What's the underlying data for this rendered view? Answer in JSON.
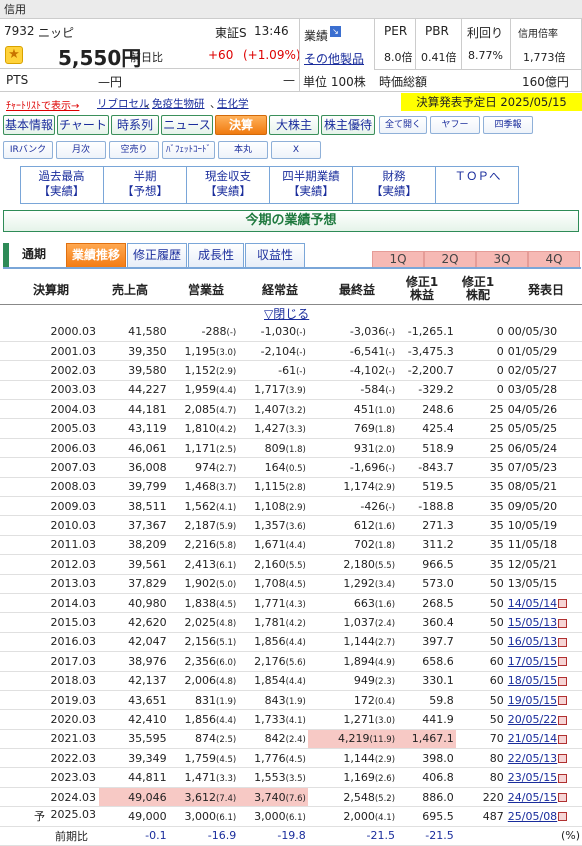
{
  "top": {
    "credit": "信用",
    "code": "7932",
    "name": "ニッピ",
    "market": "東証S",
    "time": "13:46",
    "price": "5,550円",
    "prev_label": "前日比",
    "change": "+60",
    "change_pct": "(+1.09%)",
    "pts_label": "PTS",
    "pts_value": "—円",
    "pts_dash": "—"
  },
  "sector": {
    "label": "業績",
    "value": "その他製品",
    "unit": "単位 100株"
  },
  "ratios": {
    "per_label": "PER",
    "per": "8.0倍",
    "pbr_label": "PBR",
    "pbr": "0.41倍",
    "yield_label": "利回り",
    "yield": "8.77%",
    "margin_label": "信用倍率",
    "margin": "1,773倍"
  },
  "mcap": {
    "label": "時価総額",
    "value": "160億円"
  },
  "info": {
    "watch": "ﾁｬｰﾄﾘｽﾄで表示→",
    "link1": "リブロセル",
    "link2": "免疫生物研",
    "link3": "生化学",
    "sep": "、",
    "settlement": "決算発表予定日 2025/05/15"
  },
  "nav1": [
    "基本情報",
    "チャート",
    "時系列",
    "ニュース",
    "決算",
    "大株主",
    "株主優待",
    "全て開く",
    "ヤフー",
    "四季報"
  ],
  "nav2": [
    "IRバンク",
    "月次",
    "空売り",
    "ﾊﾞﾌｪｯﾄｺｰﾄﾞ",
    "本丸",
    "X"
  ],
  "subnav": [
    [
      "過去最高",
      "【実績】"
    ],
    [
      "半期",
      "【予想】"
    ],
    [
      "現金収支",
      "【実績】"
    ],
    [
      "四半期業績",
      "【実績】"
    ],
    [
      "財務",
      "【実績】"
    ],
    [
      "ＴＯＰへ",
      ""
    ]
  ],
  "section_title": "今期の業績予想",
  "tabs": {
    "period": "通期",
    "items": [
      "業績推移",
      "修正履歴",
      "成長性",
      "収益性"
    ],
    "quarters": [
      "1Q",
      "2Q",
      "3Q",
      "4Q"
    ]
  },
  "headers": [
    "決算期",
    "売上高",
    "営業益",
    "経常益",
    "最終益",
    "修正1株益",
    "修正1株配",
    "発表日"
  ],
  "close_label": "▽閉じる",
  "rows": [
    [
      "2000.03",
      "41,580",
      "-288",
      "(-)",
      "-1,030",
      "(-)",
      "-3,036",
      "(-)",
      "-1,265.1",
      "0",
      "00/05/30"
    ],
    [
      "2001.03",
      "39,350",
      "1,195",
      "(3.0)",
      "-2,104",
      "(-)",
      "-6,541",
      "(-)",
      "-3,475.3",
      "0",
      "01/05/29"
    ],
    [
      "2002.03",
      "39,580",
      "1,152",
      "(2.9)",
      "-61",
      "(-)",
      "-4,102",
      "(-)",
      "-2,200.7",
      "0",
      "02/05/27"
    ],
    [
      "2003.03",
      "44,227",
      "1,959",
      "(4.4)",
      "1,717",
      "(3.9)",
      "-584",
      "(-)",
      "-329.2",
      "0",
      "03/05/28"
    ],
    [
      "2004.03",
      "44,181",
      "2,085",
      "(4.7)",
      "1,407",
      "(3.2)",
      "451",
      "(1.0)",
      "248.6",
      "25",
      "04/05/26"
    ],
    [
      "2005.03",
      "43,119",
      "1,810",
      "(4.2)",
      "1,427",
      "(3.3)",
      "769",
      "(1.8)",
      "425.4",
      "25",
      "05/05/25"
    ],
    [
      "2006.03",
      "46,061",
      "1,171",
      "(2.5)",
      "809",
      "(1.8)",
      "931",
      "(2.0)",
      "518.9",
      "25",
      "06/05/24"
    ],
    [
      "2007.03",
      "36,008",
      "974",
      "(2.7)",
      "164",
      "(0.5)",
      "-1,696",
      "(-)",
      "-843.7",
      "35",
      "07/05/23"
    ],
    [
      "2008.03",
      "39,799",
      "1,468",
      "(3.7)",
      "1,115",
      "(2.8)",
      "1,174",
      "(2.9)",
      "519.5",
      "35",
      "08/05/21"
    ],
    [
      "2009.03",
      "38,511",
      "1,562",
      "(4.1)",
      "1,108",
      "(2.9)",
      "-426",
      "(-)",
      "-188.8",
      "35",
      "09/05/20"
    ],
    [
      "2010.03",
      "37,367",
      "2,187",
      "(5.9)",
      "1,357",
      "(3.6)",
      "612",
      "(1.6)",
      "271.3",
      "35",
      "10/05/19"
    ],
    [
      "2011.03",
      "38,209",
      "2,216",
      "(5.8)",
      "1,671",
      "(4.4)",
      "702",
      "(1.8)",
      "311.2",
      "35",
      "11/05/18"
    ],
    [
      "2012.03",
      "39,561",
      "2,413",
      "(6.1)",
      "2,160",
      "(5.5)",
      "2,180",
      "(5.5)",
      "966.5",
      "35",
      "12/05/21"
    ],
    [
      "2013.03",
      "37,829",
      "1,902",
      "(5.0)",
      "1,708",
      "(4.5)",
      "1,292",
      "(3.4)",
      "573.0",
      "50",
      "13/05/15"
    ],
    [
      "2014.03",
      "40,980",
      "1,838",
      "(4.5)",
      "1,771",
      "(4.3)",
      "663",
      "(1.6)",
      "268.5",
      "50",
      "14/05/14"
    ],
    [
      "2015.03",
      "42,620",
      "2,025",
      "(4.8)",
      "1,781",
      "(4.2)",
      "1,037",
      "(2.4)",
      "360.4",
      "50",
      "15/05/13"
    ],
    [
      "2016.03",
      "42,047",
      "2,156",
      "(5.1)",
      "1,856",
      "(4.4)",
      "1,144",
      "(2.7)",
      "397.7",
      "50",
      "16/05/13"
    ],
    [
      "2017.03",
      "38,976",
      "2,356",
      "(6.0)",
      "2,176",
      "(5.6)",
      "1,894",
      "(4.9)",
      "658.6",
      "60",
      "17/05/15"
    ],
    [
      "2018.03",
      "42,137",
      "2,006",
      "(4.8)",
      "1,854",
      "(4.4)",
      "949",
      "(2.3)",
      "330.1",
      "60",
      "18/05/15"
    ],
    [
      "2019.03",
      "43,651",
      "831",
      "(1.9)",
      "843",
      "(1.9)",
      "172",
      "(0.4)",
      "59.8",
      "50",
      "19/05/15"
    ],
    [
      "2020.03",
      "42,410",
      "1,856",
      "(4.4)",
      "1,733",
      "(4.1)",
      "1,271",
      "(3.0)",
      "441.9",
      "50",
      "20/05/22"
    ],
    [
      "2021.03",
      "35,595",
      "874",
      "(2.5)",
      "842",
      "(2.4)",
      "4,219",
      "(11.9)",
      "1,467.1",
      "70",
      "21/05/14"
    ],
    [
      "2022.03",
      "39,349",
      "1,759",
      "(4.5)",
      "1,776",
      "(4.5)",
      "1,144",
      "(2.9)",
      "398.0",
      "80",
      "22/05/13"
    ],
    [
      "2023.03",
      "44,811",
      "1,471",
      "(3.3)",
      "1,553",
      "(3.5)",
      "1,169",
      "(2.6)",
      "406.8",
      "80",
      "23/05/15"
    ],
    [
      "2024.03",
      "49,046",
      "3,612",
      "(7.4)",
      "3,740",
      "(7.6)",
      "2,548",
      "(5.2)",
      "886.0",
      "220",
      "24/05/15"
    ],
    [
      "2025.03",
      "49,000",
      "3,000",
      "(6.1)",
      "3,000",
      "(6.1)",
      "2,000",
      "(4.1)",
      "695.5",
      "487",
      "25/05/08"
    ]
  ],
  "forecast_mark": "予",
  "yoy": {
    "label": "前期比",
    "values": [
      "-0.1",
      "-16.9",
      "-19.8",
      "-21.5",
      "-21.5"
    ],
    "unit": "(%)"
  }
}
